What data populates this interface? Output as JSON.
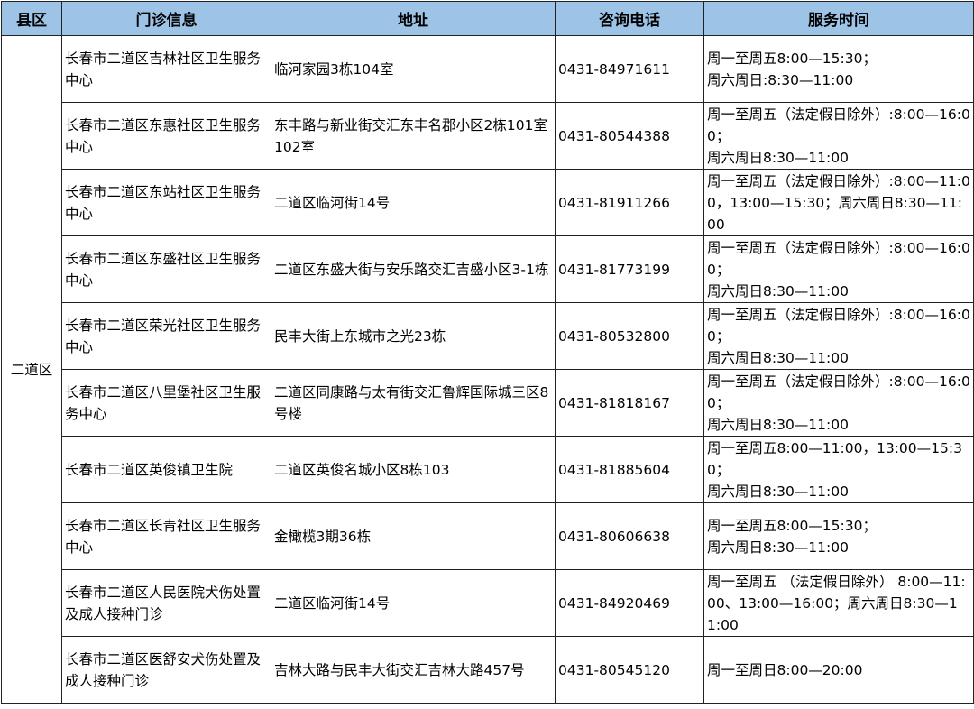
{
  "colors": {
    "header_bg": "#9dc3e6",
    "border": "#222222",
    "text": "#000000"
  },
  "table": {
    "headers": [
      "县区",
      "门诊信息",
      "地址",
      "咨询电话",
      "服务时间"
    ],
    "district": "二道区",
    "rows": [
      {
        "clinic": "长春市二道区吉林社区卫生服务中心",
        "address": "临河家园3栋104室",
        "phone": "0431-84971611",
        "hours": "周一至周五8:00—15:30；\n周六周日:8:30—11:00"
      },
      {
        "clinic": "长春市二道区东惠社区卫生服务中心",
        "address": "东丰路与新业街交汇东丰名郡小区2栋101室102室",
        "phone": "0431-80544388",
        "hours": "周一至周五（法定假日除外）:8:00—16:00；\n周六周日8:30—11:00"
      },
      {
        "clinic": "长春市二道区东站社区卫生服务中心",
        "address": "二道区临河街14号",
        "phone": "0431-81911266",
        "hours": "周一至周五（法定假日除外）:8:00—11:00，13:00—15:30；周六周日8:30—11:00"
      },
      {
        "clinic": "长春市二道区东盛社区卫生服务中心",
        "address": "二道区东盛大街与安乐路交汇吉盛小区3-1栋",
        "phone": "0431-81773199",
        "hours": "周一至周五（法定假日除外）:8:00—16:00；\n周六周日8:30—11:00"
      },
      {
        "clinic": "长春市二道区荣光社区卫生服务中心",
        "address": "民丰大街上东城市之光23栋",
        "phone": "0431-80532800",
        "hours": "周一至周五（法定假日除外）:8:00—16:00；\n周六周日8:30—11:00"
      },
      {
        "clinic": "长春市二道区八里堡社区卫生服务中心",
        "address": "二道区同康路与太有街交汇鲁辉国际城三区8号楼",
        "phone": "0431-81818167",
        "hours": "周一至周五（法定假日除外）:8:00—16:00；\n周六周日8:30—11:00"
      },
      {
        "clinic": "长春市二道区英俊镇卫生院",
        "address": "二道区英俊名城小区8栋103",
        "phone": "0431-81885604",
        "hours": "周一至周五8:00—11:00，13:00—15:30；\n周六周日8:30—11:00"
      },
      {
        "clinic": "长春市二道区长青社区卫生服务中心",
        "address": "金橄榄3期36栋",
        "phone": "0431-80606638",
        "hours": "周一至周五8:00—15:30；\n周六周日8:30—11:00"
      },
      {
        "clinic": "长春市二道区人民医院犬伤处置及成人接种门诊",
        "address": "二道区临河街14号",
        "phone": "0431-84920469",
        "hours": "周一至周五 （法定假日除外） 8:00—11:00、13:00—16:00；周六周日8:30—11:00"
      },
      {
        "clinic": "长春市二道区医舒安犬伤处置及成人接种门诊",
        "address": "吉林大路与民丰大街交汇吉林大路457号",
        "phone": "0431-80545120",
        "hours": "周一至周日8:00—20:00"
      }
    ]
  }
}
